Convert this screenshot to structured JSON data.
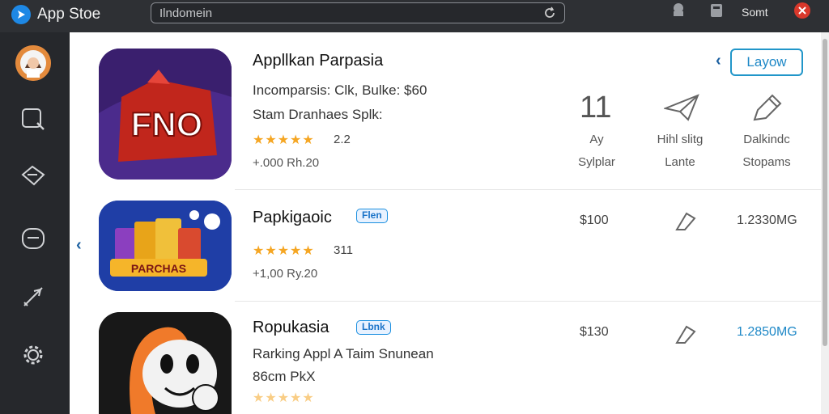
{
  "topbar": {
    "app_title": "App Stoe",
    "search_value": "Ilndomein",
    "user_label": "Somt"
  },
  "apps": [
    {
      "name": "Appllkan Parpasia",
      "line1": "Incomparsis: Clk, Bulke: $60",
      "line2": "Stam Dranhaes Splk:",
      "stars": "★★★★★",
      "rating": "2.2",
      "price": "+.000 Rh.20",
      "icon_text": "FNO"
    },
    {
      "name": "Papkigaoic",
      "badge": "Flen",
      "stars": "★★★★★",
      "rating": "311",
      "price": "+1,00 Ry.20",
      "col_price": "$100",
      "col_size": "1.2330MG",
      "icon_text": "PARCHAS"
    },
    {
      "name": "Ropukasia",
      "badge": "Lbnk",
      "line1": "Rarking Appl A Taim Snunean",
      "line2": "86cm PkX",
      "stars": "★★★★★",
      "col_price": "$130",
      "col_size": "1.2850MG"
    }
  ],
  "detail": {
    "button_label": "Layow",
    "stat1_big": "11",
    "stat1_l1": "Ay",
    "stat1_l2": "Sylplar",
    "stat2_l1": "Hihl slitg",
    "stat2_l2": "Lante",
    "stat3_l1": "Dalkindc",
    "stat3_l2": "Stopams"
  },
  "icons": [
    "app-store-logo",
    "refresh-icon",
    "bell-icon",
    "trash-icon",
    "close-icon",
    "search-icon",
    "tag-icon",
    "inbox-icon",
    "rocket-icon",
    "gear-icon",
    "send-icon",
    "pencil-icon",
    "chart-icon"
  ],
  "colors": {
    "accent": "#1e88c7",
    "stars": "#f5a623",
    "topbar": "#2e3034"
  }
}
